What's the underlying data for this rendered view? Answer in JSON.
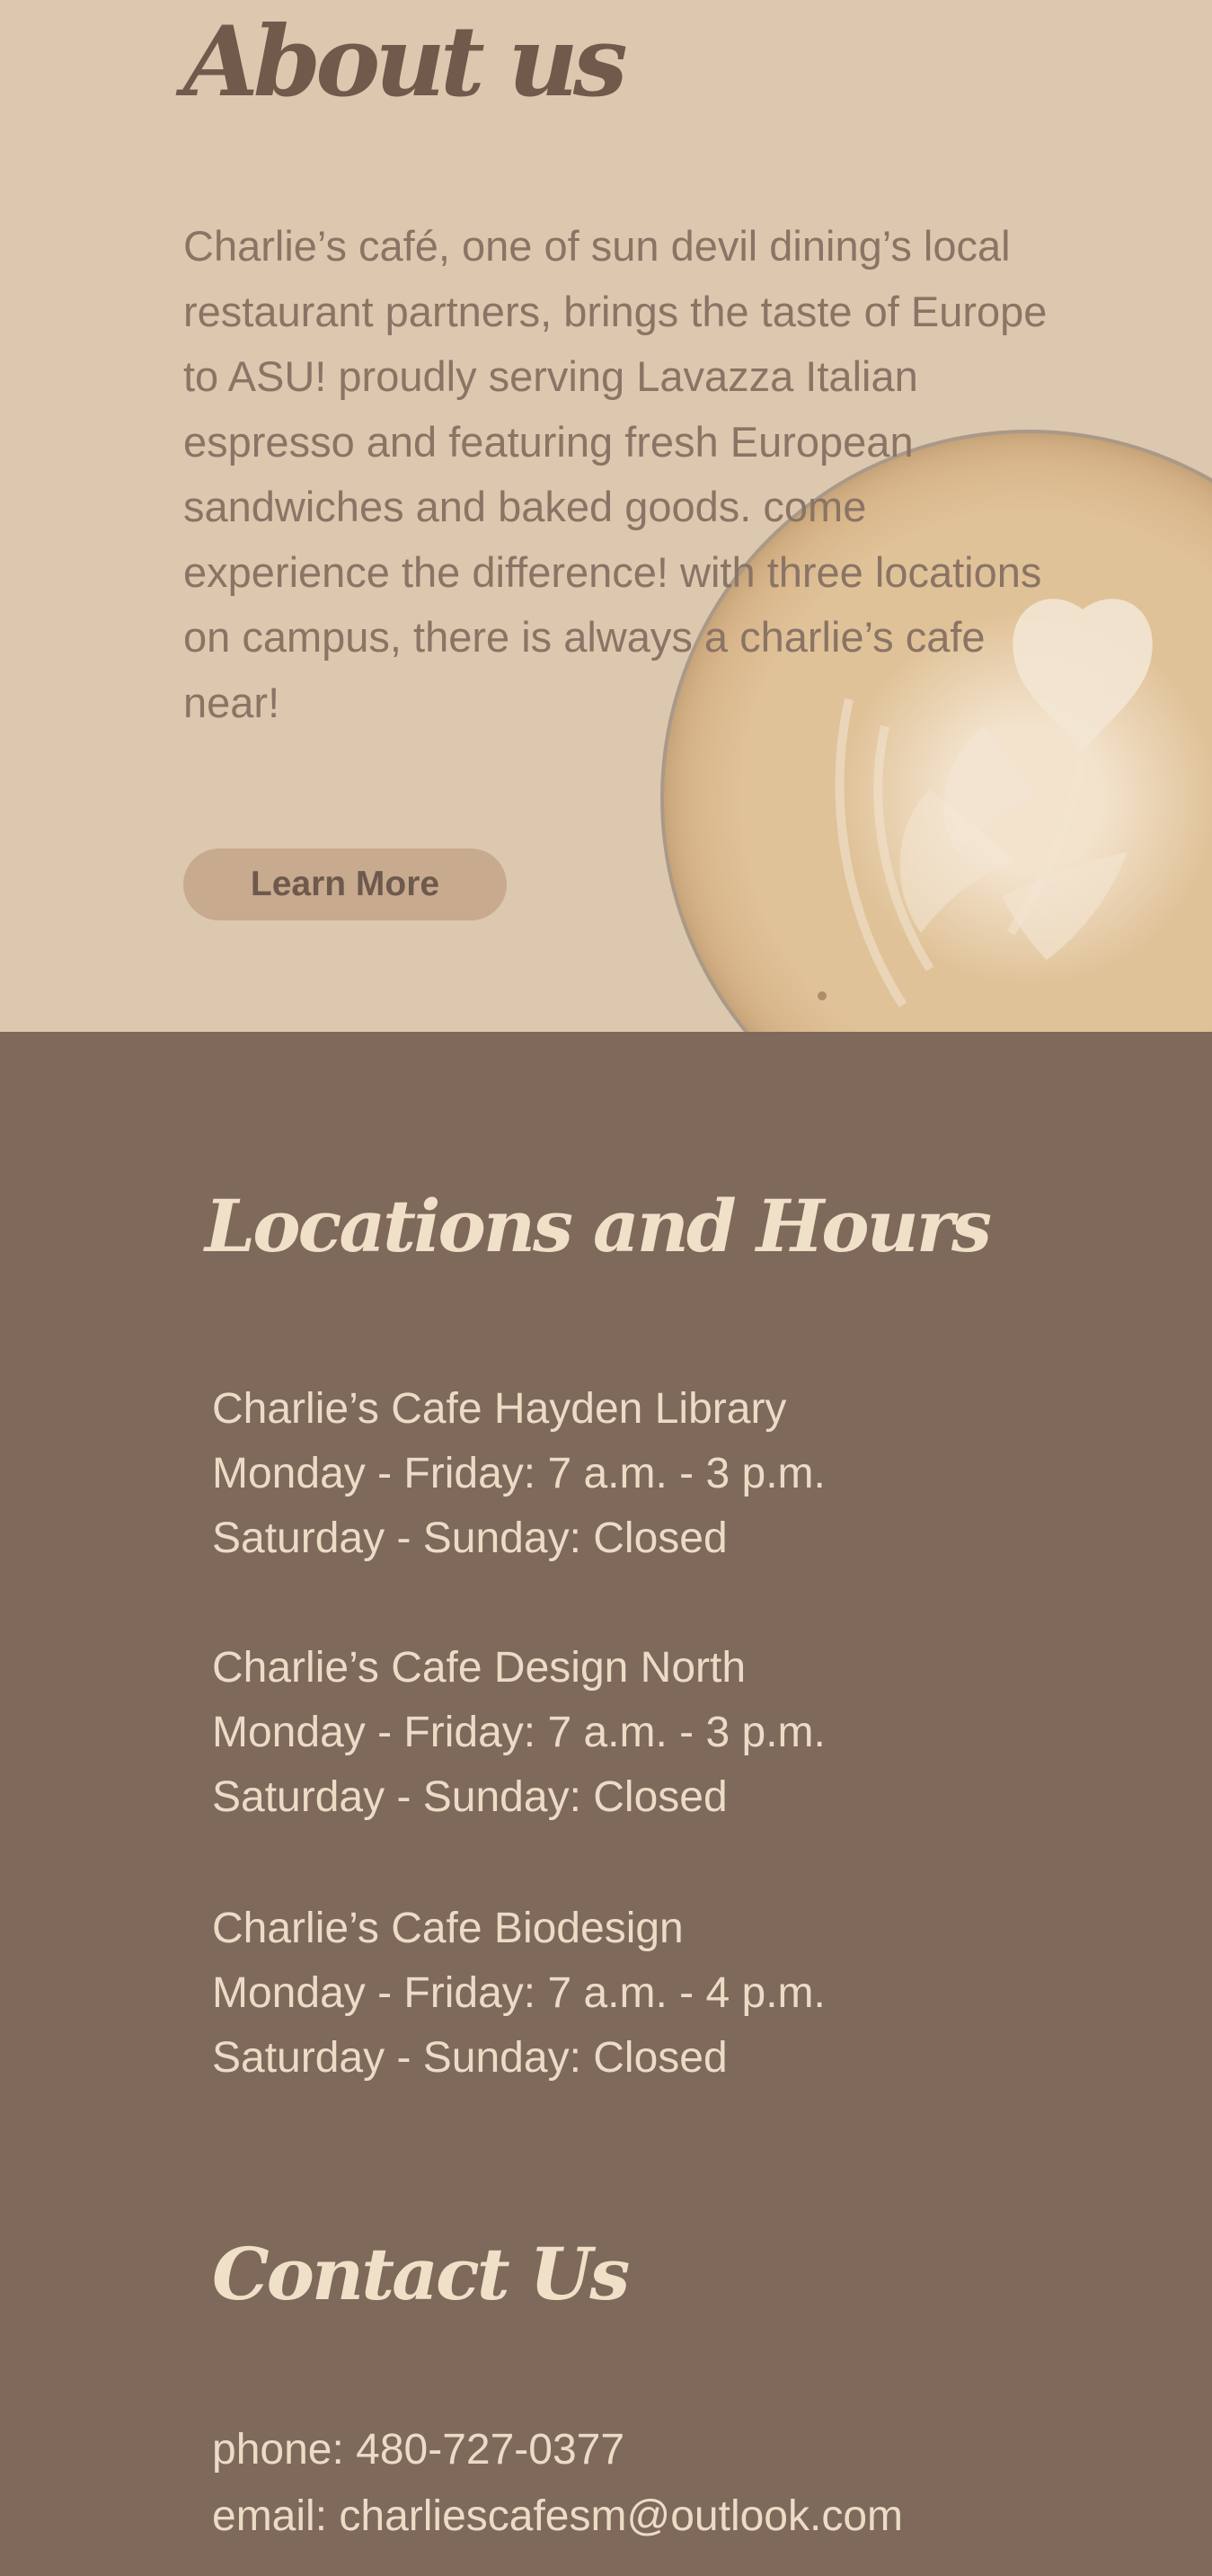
{
  "about": {
    "title": "About us",
    "body": "Charlie’s café, one of sun devil dining’s local restaurant partners, brings the taste of Europe to ASU! proudly serving Lavazza Italian espresso and featuring fresh European sandwiches and baked goods. come experience the difference! with three locations on campus, there is always a charlie’s cafe near!",
    "button_label": "Learn More"
  },
  "locations": {
    "title": "Locations and Hours",
    "items": [
      {
        "name": "Charlie’s Cafe Hayden Library",
        "weekday": "Monday - Friday: 7 a.m. - 3 p.m.",
        "weekend": "Saturday - Sunday: Closed"
      },
      {
        "name": "Charlie’s Cafe Design North",
        "weekday": "Monday - Friday: 7 a.m. - 3 p.m.",
        "weekend": "Saturday - Sunday: Closed"
      },
      {
        "name": "Charlie’s Cafe Biodesign",
        "weekday": "Monday - Friday: 7 a.m. - 4 p.m.",
        "weekend": "Saturday - Sunday: Closed"
      }
    ]
  },
  "contact": {
    "title": "Contact Us",
    "phone": "phone: 480-727-0377",
    "email": "email: charliescafesm@outlook.com"
  },
  "colors": {
    "about_bg": "#dcc8af",
    "dark_bg": "#7e695a",
    "button_bg": "#c8aa8f",
    "light_text": "#ecdcc6"
  },
  "icons": [
    "latte-art-image"
  ]
}
